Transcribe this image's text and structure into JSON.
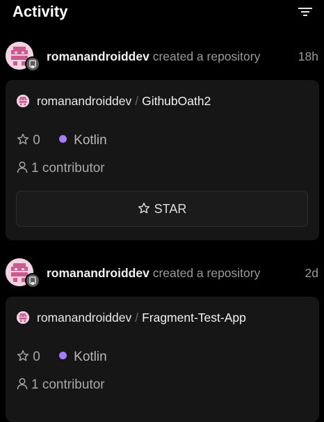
{
  "header": {
    "title": "Activity",
    "filter_icon": "filter-icon"
  },
  "events": [
    {
      "user": "romanandroiddev",
      "action": "created a repository",
      "time": "18h",
      "avatar_icon": "identicon-avatar",
      "badge_icon": "repo-icon",
      "repo": {
        "owner": "romanandroiddev",
        "separator": "/",
        "name": "GithubOath2",
        "stars": "0",
        "language": "Kotlin",
        "language_color": "#a97bff",
        "contributors": "1 contributor",
        "star_label": "STAR"
      }
    },
    {
      "user": "romanandroiddev",
      "action": "created a repository",
      "time": "2d",
      "avatar_icon": "identicon-avatar",
      "badge_icon": "repo-icon",
      "repo": {
        "owner": "romanandroiddev",
        "separator": "/",
        "name": "Fragment-Test-App",
        "stars": "0",
        "language": "Kotlin",
        "language_color": "#a97bff",
        "contributors": "1 contributor"
      }
    }
  ],
  "colors": {
    "background": "#000000",
    "card": "#161616",
    "identicon": "#c95b8f",
    "identicon_bg": "#f2d3e2",
    "kotlin": "#a97bff"
  }
}
